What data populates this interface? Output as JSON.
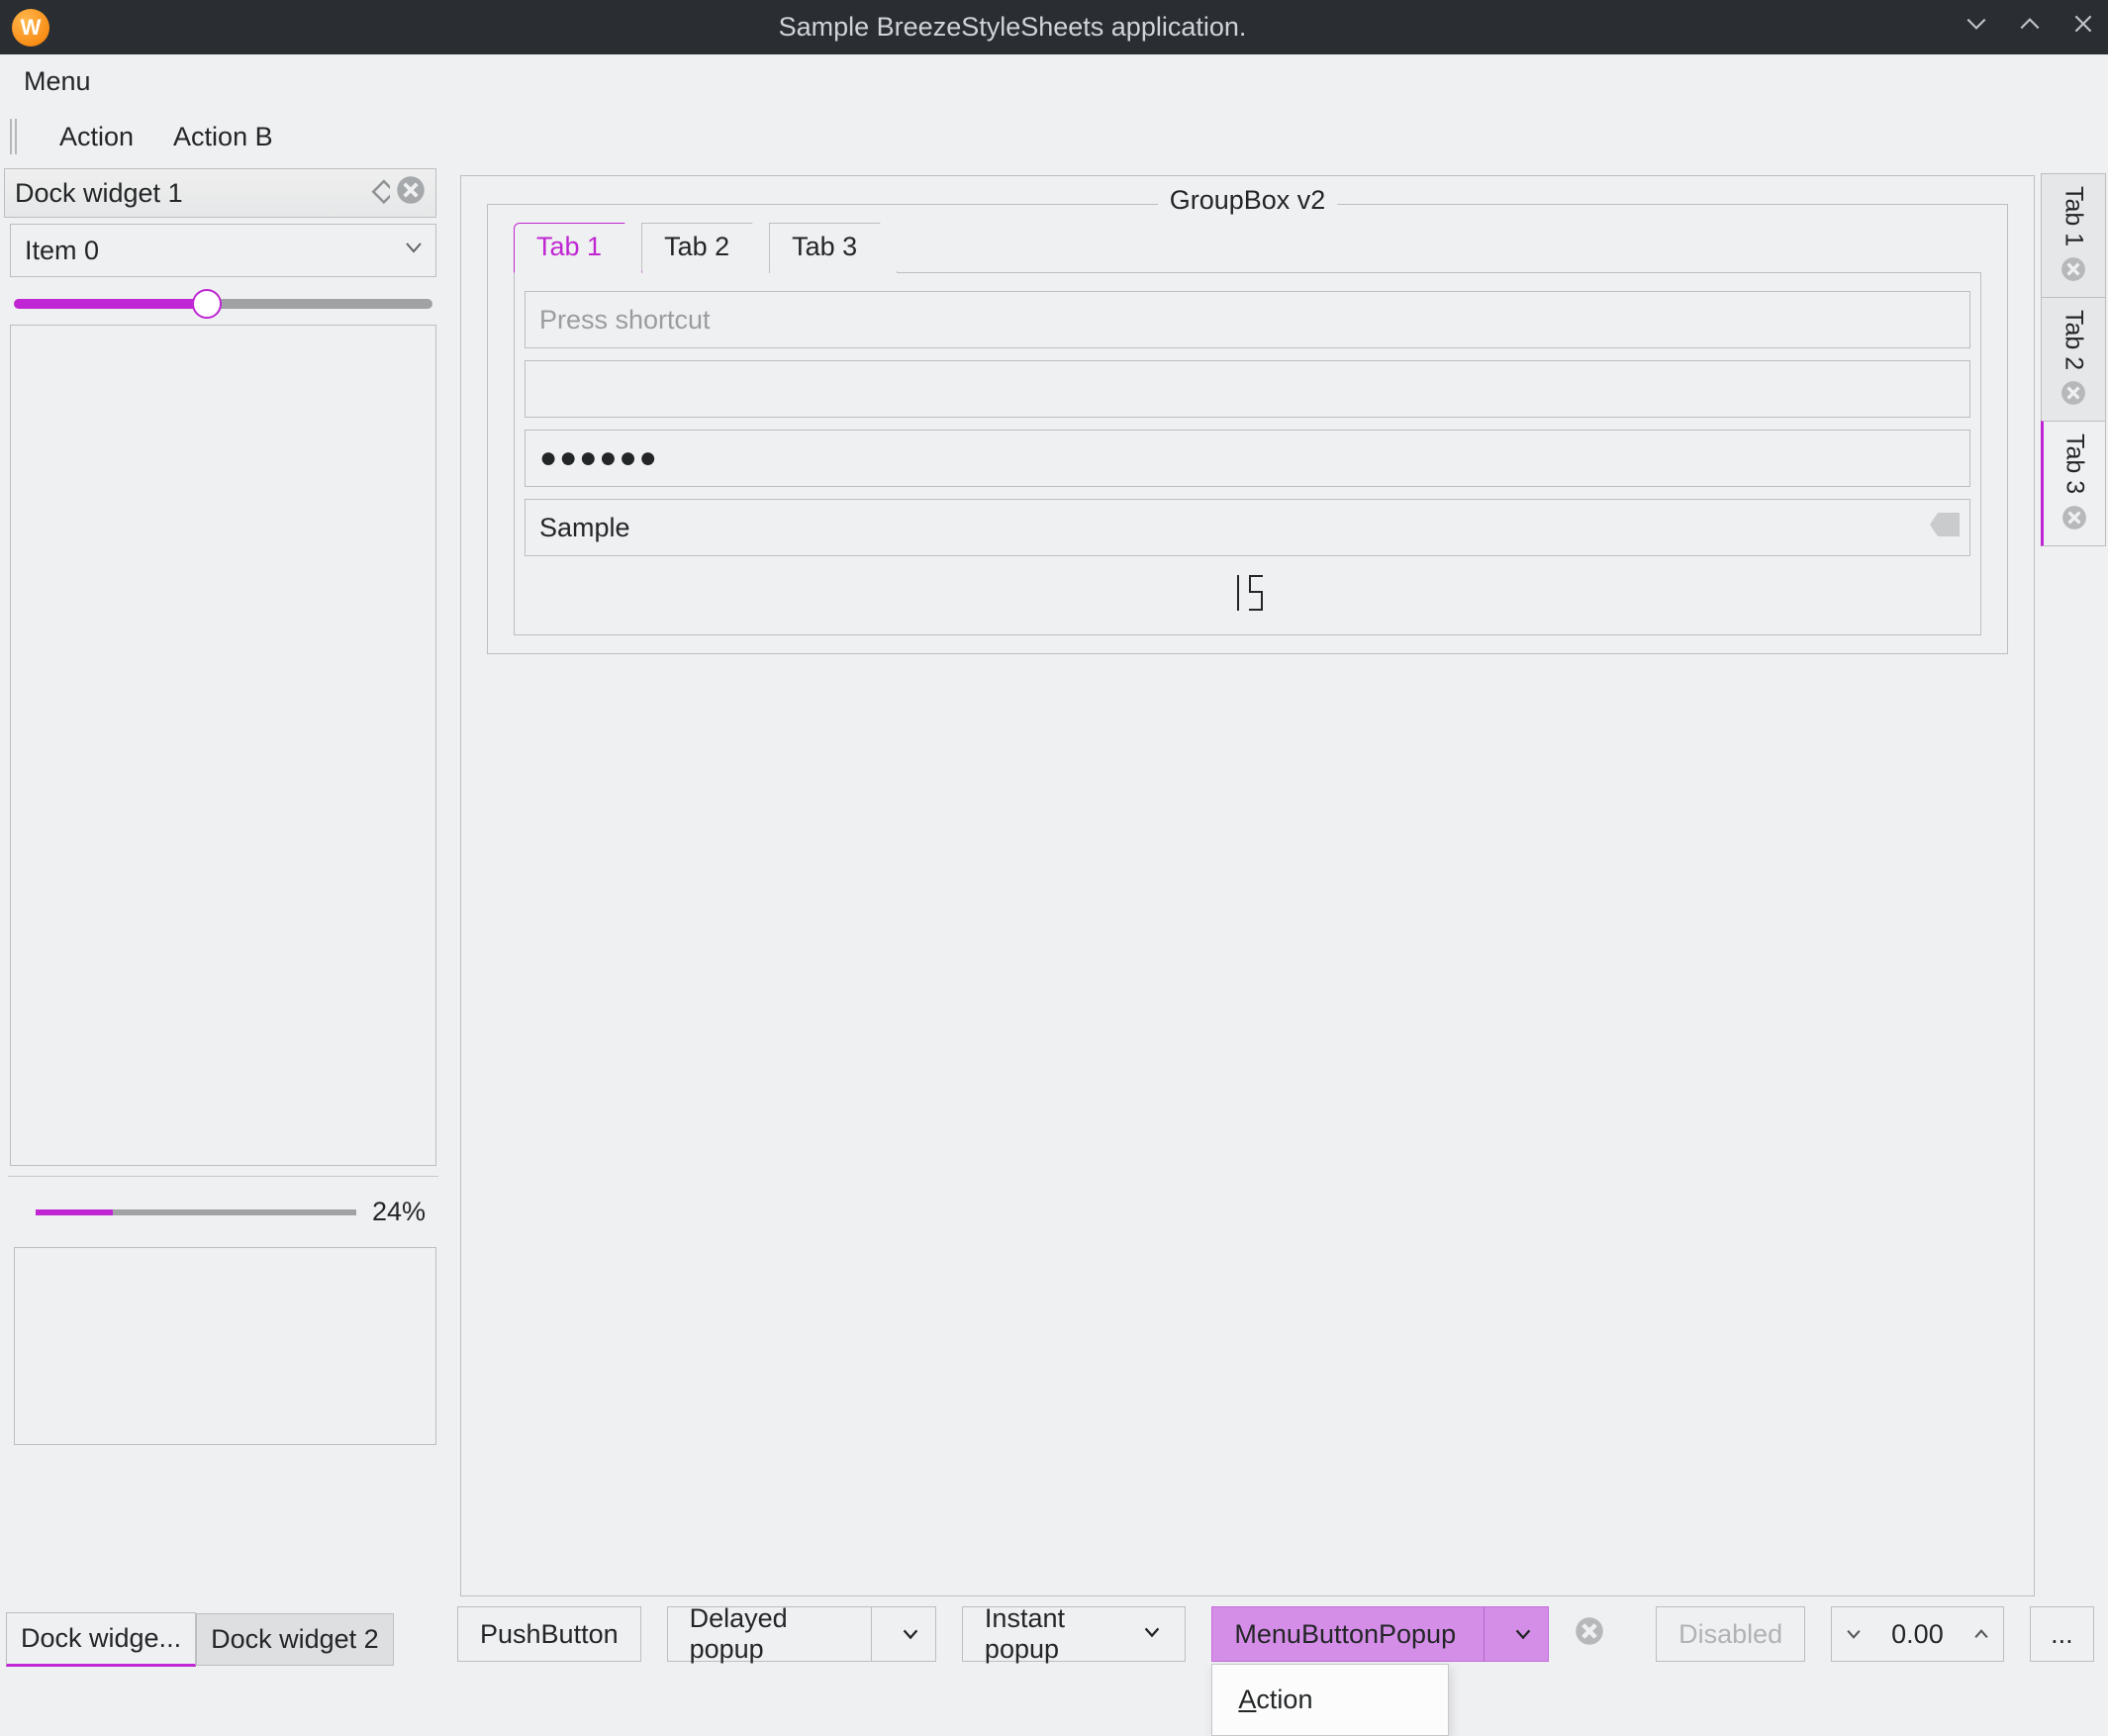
{
  "window": {
    "title": "Sample BreezeStyleSheets application.",
    "app_icon_letter": "W"
  },
  "menubar": {
    "menu_label": "Menu"
  },
  "toolbar": {
    "action_a": "Action",
    "action_b": "Action B"
  },
  "dock1": {
    "title": "Dock widget 1",
    "combo_value": "Item 0",
    "slider_percent": 46,
    "progress_percent": 24,
    "progress_label": "24%"
  },
  "groupbox": {
    "title": "GroupBox v2",
    "tabs": [
      "Tab 1",
      "Tab 2",
      "Tab 3"
    ],
    "active_tab_index": 0,
    "shortcut_placeholder": "Press shortcut",
    "password_masked": "●●●●●●",
    "sample_value": "Sample",
    "lcd_value": "15"
  },
  "right_tabs": {
    "items": [
      "Tab 1",
      "Tab 2",
      "Tab 3"
    ],
    "active_index": 2
  },
  "bottom_dock_tabs": {
    "items": [
      "Dock widge...",
      "Dock widget 2"
    ],
    "active_index": 0
  },
  "bottom_buttons": {
    "push": "PushButton",
    "delayed": "Delayed popup",
    "instant": "Instant popup",
    "menubtn": "MenuButtonPopup",
    "disabled": "Disabled",
    "spin_value": "0.00",
    "ellipsis": "..."
  },
  "popup": {
    "action_label": "Action"
  },
  "colors": {
    "accent": "#c026d3"
  }
}
